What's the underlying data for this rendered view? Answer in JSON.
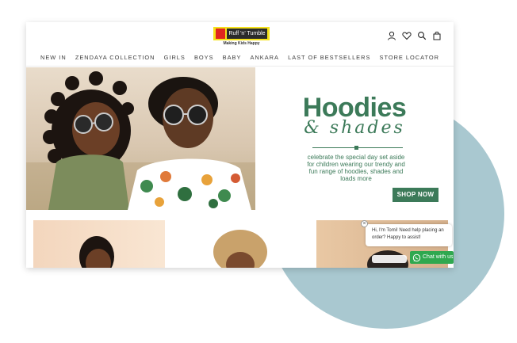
{
  "brand": {
    "logo_text": "Ruff 'n' Tumble",
    "tagline": "Making Kids Happy"
  },
  "header_icons": [
    "account-icon",
    "wishlist-heart-icon",
    "search-icon",
    "cart-bag-icon"
  ],
  "nav": {
    "items": [
      {
        "label": "NEW IN"
      },
      {
        "label": "ZENDAYA COLLECTION"
      },
      {
        "label": "GIRLS"
      },
      {
        "label": "BOYS"
      },
      {
        "label": "BABY"
      },
      {
        "label": "ANKARA"
      },
      {
        "label": "LAST OF BESTSELLERS"
      },
      {
        "label": "STORE LOCATOR"
      }
    ]
  },
  "hero": {
    "title": "Hoodies",
    "subtitle": "& shades",
    "text": "celebrate the special day set aside for children wearing our trendy and fun range of hoodies, shades and loads more",
    "cta": "SHOP NOW"
  },
  "chat": {
    "message": "Hi, I'm Tomi! Need help placing an order? Happy to assist!",
    "button": "Chat with us",
    "close": "×"
  },
  "colors": {
    "accent_green": "#3c7a59",
    "blob_blue": "#a9c8d0",
    "whatsapp_green": "#2fa84f",
    "logo_yellow": "#f5e21b",
    "logo_red": "#e0261e"
  }
}
